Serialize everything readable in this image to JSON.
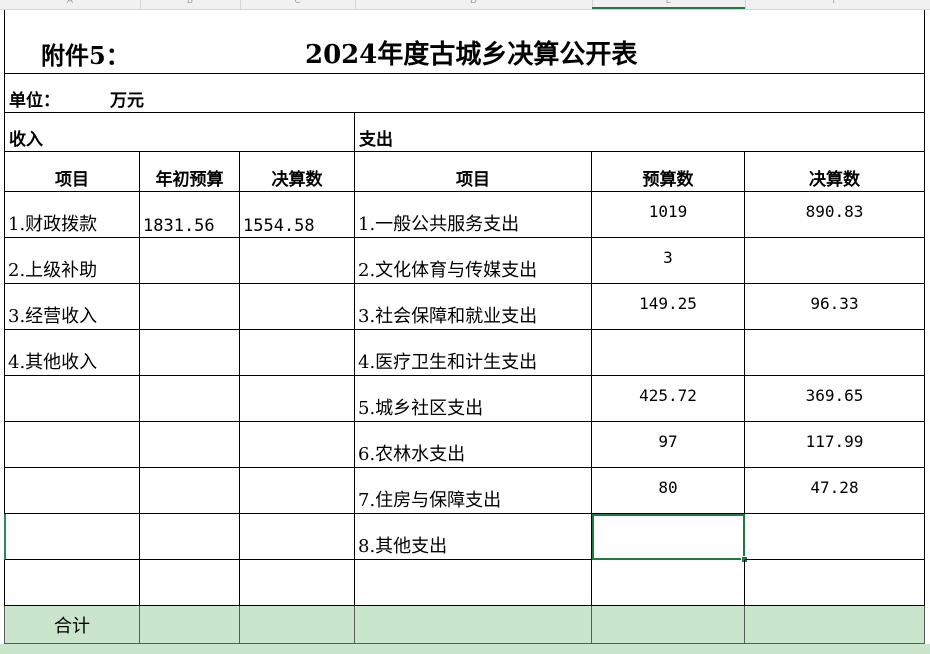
{
  "columns": [
    "A",
    "B",
    "C",
    "D",
    "E",
    "F"
  ],
  "title": {
    "attachment": "附件5：",
    "main": "2024年度古城乡决算公开表"
  },
  "unit": {
    "label": "单位：",
    "value": "万元"
  },
  "sections": {
    "income": "收入",
    "expense": "支出"
  },
  "headers": {
    "income_item": "项目",
    "income_budget": "年初预算",
    "income_final": "决算数",
    "expense_item": "项目",
    "expense_budget": "预算数",
    "expense_final": "决算数"
  },
  "income_rows": [
    {
      "item": "1.财政拨款",
      "budget": "1831.56",
      "final": "1554.58"
    },
    {
      "item": "2.上级补助",
      "budget": "",
      "final": ""
    },
    {
      "item": "3.经营收入",
      "budget": "",
      "final": ""
    },
    {
      "item": "4.其他收入",
      "budget": "",
      "final": ""
    }
  ],
  "expense_rows": [
    {
      "item": "1.一般公共服务支出",
      "budget": "1019",
      "final": "890.83"
    },
    {
      "item": "2.文化体育与传媒支出",
      "budget": "3",
      "final": ""
    },
    {
      "item": "3.社会保障和就业支出",
      "budget": "149.25",
      "final": "96.33"
    },
    {
      "item": "4.医疗卫生和计生支出",
      "budget": "",
      "final": ""
    },
    {
      "item": "5.城乡社区支出",
      "budget": "425.72",
      "final": "369.65"
    },
    {
      "item": "6.农林水支出",
      "budget": "97",
      "final": "117.99"
    },
    {
      "item": "7.住房与保障支出",
      "budget": "80",
      "final": "47.28"
    },
    {
      "item": "8.其他支出",
      "budget": "",
      "final": ""
    }
  ],
  "total_label": "合计",
  "colors": {
    "total_fill": "#c9e6cc",
    "selection": "#1e7a40"
  }
}
